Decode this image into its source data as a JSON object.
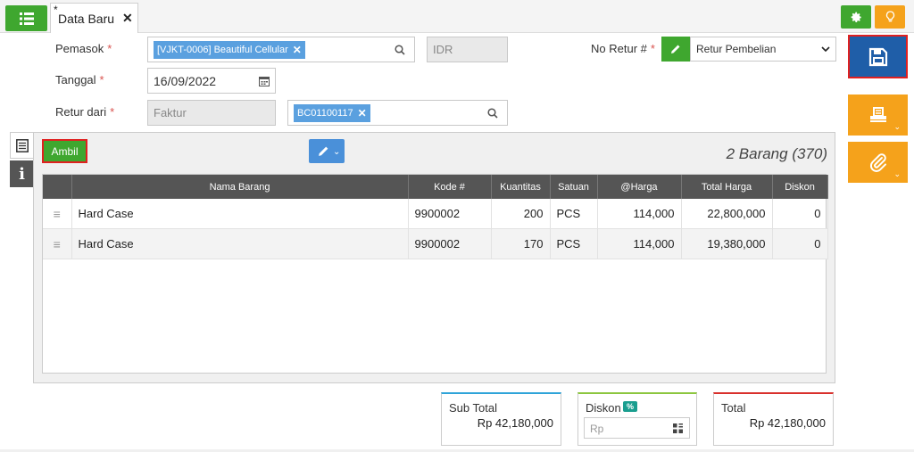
{
  "tab": {
    "modified_marker": "*",
    "title": "Data Baru"
  },
  "form": {
    "supplier_label": "Pemasok",
    "supplier_chip": "[VJKT-0006] Beautiful Cellular",
    "currency": "IDR",
    "return_no_label": "No Retur #",
    "return_type_selected": "Retur Pembelian",
    "date_label": "Tanggal",
    "date_value": "16/09/2022",
    "return_from_label": "Retur dari",
    "return_from_value": "Faktur",
    "invoice_chip": "BC01100117",
    "required_mark": "*"
  },
  "toolbar": {
    "ambil_label": "Ambil",
    "items_count": "2 Barang (370)"
  },
  "table": {
    "headers": [
      "Nama Barang",
      "Kode #",
      "Kuantitas",
      "Satuan",
      "@Harga",
      "Total Harga",
      "Diskon"
    ],
    "rows": [
      {
        "name": "Hard Case",
        "code": "9900002",
        "qty": "200",
        "unit": "PCS",
        "price": "114,000",
        "total": "22,800,000",
        "discount": "0"
      },
      {
        "name": "Hard Case",
        "code": "9900002",
        "qty": "170",
        "unit": "PCS",
        "price": "114,000",
        "total": "19,380,000",
        "discount": "0"
      }
    ]
  },
  "summary": {
    "subtotal_label": "Sub Total",
    "subtotal_value": "Rp 42,180,000",
    "discount_label": "Diskon",
    "discount_badge": "%",
    "discount_placeholder": "Rp",
    "total_label": "Total",
    "total_value": "Rp 42,180,000"
  },
  "colors": {
    "green": "#3fa72f",
    "orange": "#f5a21b",
    "blue": "#1f5ea8",
    "chip": "#5aa0df",
    "highlight": "#e02020"
  }
}
